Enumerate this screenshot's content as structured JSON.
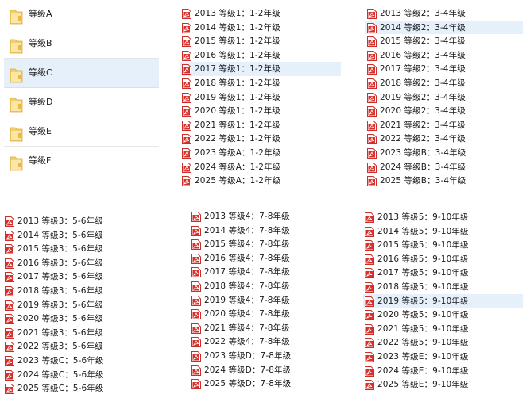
{
  "folders": [
    {
      "label": "等级A"
    },
    {
      "label": "等级B"
    },
    {
      "label": "等级C",
      "selected": true
    },
    {
      "label": "等级D"
    },
    {
      "label": "等级E"
    },
    {
      "label": "等级F"
    }
  ],
  "file_lists": [
    {
      "files": [
        "2013 等级1：1-2年级",
        "2014 等级1：1-2年级",
        "2015 等级1：1-2年级",
        "2016 等级1：1-2年级",
        "2017 等级1：1-2年级",
        "2018 等级1：1-2年级",
        "2019 等级1：1-2年级",
        "2020 等级1：1-2年级",
        "2021 等级1：1-2年级",
        "2022 等级1：1-2年级",
        "2023 等级A：1-2年级",
        "2024 等级A：1-2年级",
        "2025 等级A：1-2年级"
      ],
      "selected_index": 4
    },
    {
      "files": [
        "2013 等级2：3-4年级",
        "2014 等级2：3-4年级",
        "2015 等级2：3-4年级",
        "2016 等级2：3-4年级",
        "2017 等级2：3-4年级",
        "2018 等级2：3-4年级",
        "2019 等级2：3-4年级",
        "2020 等级2：3-4年级",
        "2021 等级2：3-4年级",
        "2022 等级2：3-4年级",
        "2023 等级B：3-4年级",
        "2024 等级B：3-4年级",
        "2025 等级B：3-4年级"
      ],
      "selected_index": 1
    },
    {
      "files": [
        "2013 等级3：5-6年级",
        "2014 等级3：5-6年级",
        "2015 等级3：5-6年级",
        "2016 等级3：5-6年级",
        "2017 等级3：5-6年级",
        "2018 等级3：5-6年级",
        "2019 等级3：5-6年级",
        "2020 等级3：5-6年级",
        "2021 等级3：5-6年级",
        "2022 等级3：5-6年级",
        "2023 等级C：5-6年级",
        "2024 等级C：5-6年级",
        "2025 等级C：5-6年级"
      ],
      "selected_index": -1
    },
    {
      "files": [
        "2013 等级4：7-8年级",
        "2014 等级4：7-8年级",
        "2015 等级4：7-8年级",
        "2016 等级4：7-8年级",
        "2017 等级4：7-8年级",
        "2018 等级4：7-8年级",
        "2019 等级4：7-8年级",
        "2020 等级4：7-8年级",
        "2021 等级4：7-8年级",
        "2022 等级4：7-8年级",
        "2023 等级D：7-8年级",
        "2024 等级D：7-8年级",
        "2025 等级D：7-8年级"
      ],
      "selected_index": -1
    },
    {
      "files": [
        "2013 等级5：9-10年级",
        "2014 等级5：9-10年级",
        "2015 等级5：9-10年级",
        "2016 等级5：9-10年级",
        "2017 等级5：9-10年级",
        "2018 等级5：9-10年级",
        "2019 等级5：9-10年级",
        "2020 等级5：9-10年级",
        "2021 等级5：9-10年级",
        "2022 等级5：9-10年级",
        "2023 等级E：9-10年级",
        "2024 等级E：9-10年级",
        "2025 等级E：9-10年级"
      ],
      "selected_index": 6
    }
  ],
  "icons": {
    "folder": "folder-icon",
    "file": "pdf-icon"
  },
  "colors": {
    "selection": "#e5f0fb",
    "pdf_red": "#d9302c",
    "folder_yellow": "#f3cf6b"
  }
}
